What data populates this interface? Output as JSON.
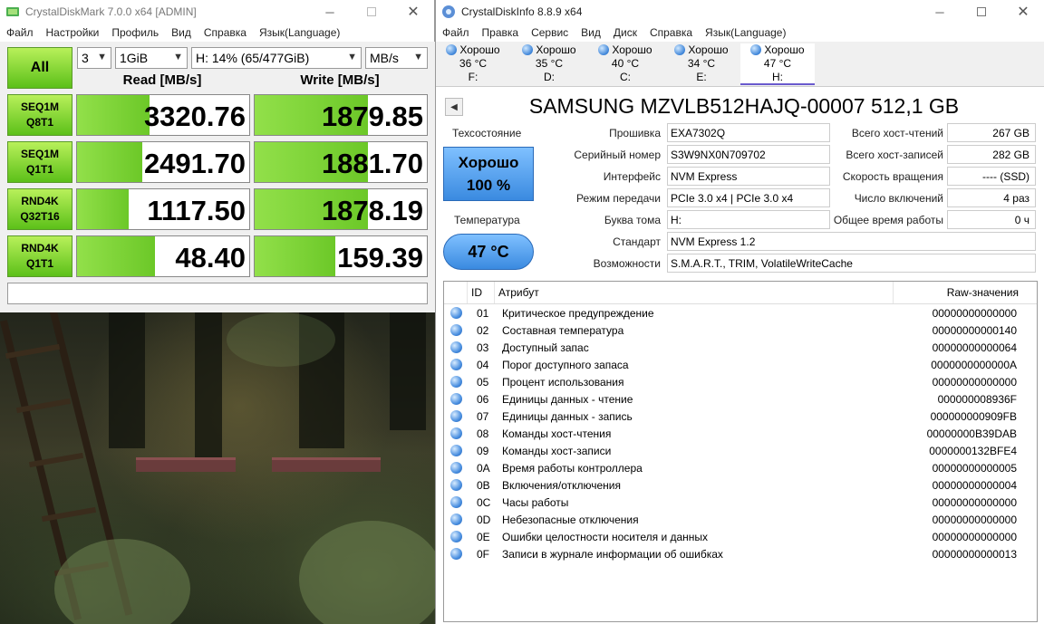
{
  "cdm": {
    "title": "CrystalDiskMark 7.0.0 x64 [ADMIN]",
    "menu": [
      "Файл",
      "Настройки",
      "Профиль",
      "Вид",
      "Справка",
      "Язык(Language)"
    ],
    "all_label": "All",
    "count": "3",
    "size": "1GiB",
    "drive": "H: 14% (65/477GiB)",
    "unit": "MB/s",
    "read_header": "Read [MB/s]",
    "write_header": "Write [MB/s]",
    "tests": [
      {
        "line1": "SEQ1M",
        "line2": "Q8T1",
        "read": "3320.76",
        "write": "1879.85",
        "read_fill": 0.42,
        "write_fill": 0.66
      },
      {
        "line1": "SEQ1M",
        "line2": "Q1T1",
        "read": "2491.70",
        "write": "1881.70",
        "read_fill": 0.38,
        "write_fill": 0.66
      },
      {
        "line1": "RND4K",
        "line2": "Q32T16",
        "read": "1117.50",
        "write": "1878.19",
        "read_fill": 0.3,
        "write_fill": 0.66
      },
      {
        "line1": "RND4K",
        "line2": "Q1T1",
        "read": "48.40",
        "write": "159.39",
        "read_fill": 0.45,
        "write_fill": 0.47
      }
    ]
  },
  "cdi": {
    "title": "CrystalDiskInfo 8.8.9 x64",
    "menu": [
      "Файл",
      "Правка",
      "Сервис",
      "Вид",
      "Диск",
      "Справка",
      "Язык(Language)"
    ],
    "drives": [
      {
        "status": "Хорошо",
        "temp": "36 °C",
        "letter": "F:"
      },
      {
        "status": "Хорошо",
        "temp": "35 °C",
        "letter": "D:"
      },
      {
        "status": "Хорошо",
        "temp": "40 °C",
        "letter": "C:"
      },
      {
        "status": "Хорошо",
        "temp": "34 °C",
        "letter": "E:"
      },
      {
        "status": "Хорошо",
        "temp": "47 °C",
        "letter": "H:"
      }
    ],
    "drive_title": "SAMSUNG MZVLB512HAJQ-00007 512,1 GB",
    "health_label": "Техсостояние",
    "health_status": "Хорошо",
    "health_percent": "100 %",
    "temp_label": "Температура",
    "temp_value": "47 °C",
    "left_info": [
      {
        "label": "Прошивка",
        "value": "EXA7302Q"
      },
      {
        "label": "Серийный номер",
        "value": "S3W9NX0N709702"
      },
      {
        "label": "Интерфейс",
        "value": "NVM Express"
      },
      {
        "label": "Режим передачи",
        "value": "PCIe 3.0 x4 | PCIe 3.0 x4"
      },
      {
        "label": "Буква тома",
        "value": "H:"
      },
      {
        "label": "Стандарт",
        "value": "NVM Express 1.2"
      },
      {
        "label": "Возможности",
        "value": "S.M.A.R.T., TRIM, VolatileWriteCache"
      }
    ],
    "right_info": [
      {
        "label": "Всего хост-чтений",
        "value": "267 GB"
      },
      {
        "label": "Всего хост-записей",
        "value": "282 GB"
      },
      {
        "label": "Скорость вращения",
        "value": "---- (SSD)"
      },
      {
        "label": "Число включений",
        "value": "4 раз"
      },
      {
        "label": "Общее время работы",
        "value": "0 ч"
      }
    ],
    "smart_headers": {
      "id": "ID",
      "attr": "Атрибут",
      "raw": "Raw-значения"
    },
    "smart_rows": [
      {
        "id": "01",
        "name": "Критическое предупреждение",
        "raw": "00000000000000"
      },
      {
        "id": "02",
        "name": "Составная температура",
        "raw": "00000000000140"
      },
      {
        "id": "03",
        "name": "Доступный запас",
        "raw": "00000000000064"
      },
      {
        "id": "04",
        "name": "Порог доступного запаса",
        "raw": "0000000000000A"
      },
      {
        "id": "05",
        "name": "Процент использования",
        "raw": "00000000000000"
      },
      {
        "id": "06",
        "name": "Единицы данных - чтение",
        "raw": "000000008936F"
      },
      {
        "id": "07",
        "name": "Единицы данных - запись",
        "raw": "000000000909FB"
      },
      {
        "id": "08",
        "name": "Команды хост-чтения",
        "raw": "00000000B39DAB"
      },
      {
        "id": "09",
        "name": "Команды хост-записи",
        "raw": "0000000132BFE4"
      },
      {
        "id": "0A",
        "name": "Время работы контроллера",
        "raw": "00000000000005"
      },
      {
        "id": "0B",
        "name": "Включения/отключения",
        "raw": "00000000000004"
      },
      {
        "id": "0C",
        "name": "Часы работы",
        "raw": "00000000000000"
      },
      {
        "id": "0D",
        "name": "Небезопасные отключения",
        "raw": "00000000000000"
      },
      {
        "id": "0E",
        "name": "Ошибки целостности носителя и данных",
        "raw": "00000000000000"
      },
      {
        "id": "0F",
        "name": "Записи в журнале информации об ошибках",
        "raw": "00000000000013"
      }
    ]
  }
}
